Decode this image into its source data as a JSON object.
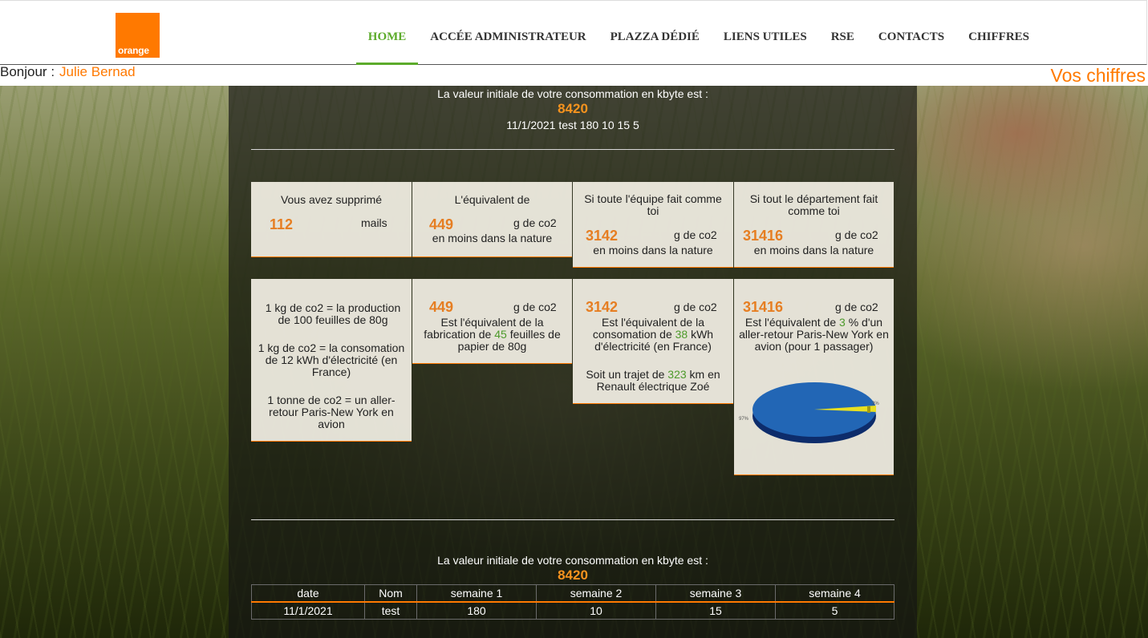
{
  "header": {
    "logo_text": "orange",
    "brand_color": "#ff7900",
    "nav": [
      {
        "label": "HOME",
        "active": true
      },
      {
        "label": "ACCÉE ADMINISTRATEUR"
      },
      {
        "label": "PLAZZA DÉDIÉ"
      },
      {
        "label": "LIENS UTILES"
      },
      {
        "label": "RSE"
      },
      {
        "label": "CONTACTS"
      },
      {
        "label": "CHIFFRES"
      }
    ],
    "active_color": "#5cab2b"
  },
  "greeting": {
    "label": "Bonjour :",
    "name": "Julie Bernad"
  },
  "vos_chiffres": "Vos chiffres",
  "top": {
    "intro": "La valeur initiale de votre consommation en kbyte est :",
    "value": "8420",
    "detail": "11/1/2021 test 180 10 15 5"
  },
  "cards_row1": [
    {
      "title": "Vous avez supprimé",
      "value": "112",
      "unit": "mails",
      "footer": ""
    },
    {
      "title": "L'équivalent de",
      "value": "449",
      "unit": "g de co2",
      "footer": "en moins dans la nature"
    },
    {
      "title": "Si toute l'équipe fait comme toi",
      "value": "3142",
      "unit": "g de co2",
      "footer": "en moins dans la nature"
    },
    {
      "title": "Si tout le département fait comme toi",
      "value": "31416",
      "unit": "g de co2",
      "footer": "en moins dans la nature"
    }
  ],
  "info_card": {
    "line1": "1 kg de co2 = la production de 100 feuilles de 80g",
    "line2": "1 kg de co2 = la consomation de 12 kWh d'électricité (en France)",
    "line3": "1 tonne de co2 = un aller-retour Paris-New York en avion"
  },
  "paper_card": {
    "value": "449",
    "unit": "g de co2",
    "text_a": "Est l'équivalent de la fabrication de",
    "sheets": "45",
    "text_b": "feuilles de papier de 80g"
  },
  "elec_card": {
    "value": "3142",
    "unit": "g de co2",
    "text_a": "Est l'équivalent de la consomation de",
    "kwh": "38",
    "text_b": "kWh d'électricité (en France)",
    "trip_a": "Soit un trajet de",
    "km": "323",
    "trip_b": "km en Renault électrique Zoé"
  },
  "plane_card": {
    "value": "31416",
    "unit": "g de co2",
    "text_a": "Est l'équivalent de",
    "pct": "3",
    "text_b": "% d'un aller-retour Paris-New York en avion (pour 1 passager)",
    "pie_label_small": "3%",
    "pie_label_big": "97%"
  },
  "bottom": {
    "intro": "La valeur initiale de votre consommation en kbyte est :",
    "value": "8420"
  },
  "table": {
    "headers": [
      "date",
      "Nom",
      "semaine 1",
      "semaine 2",
      "semaine 3",
      "semaine 4"
    ],
    "rows": [
      [
        "11/1/2021",
        "test",
        "180",
        "10",
        "15",
        "5"
      ]
    ]
  }
}
